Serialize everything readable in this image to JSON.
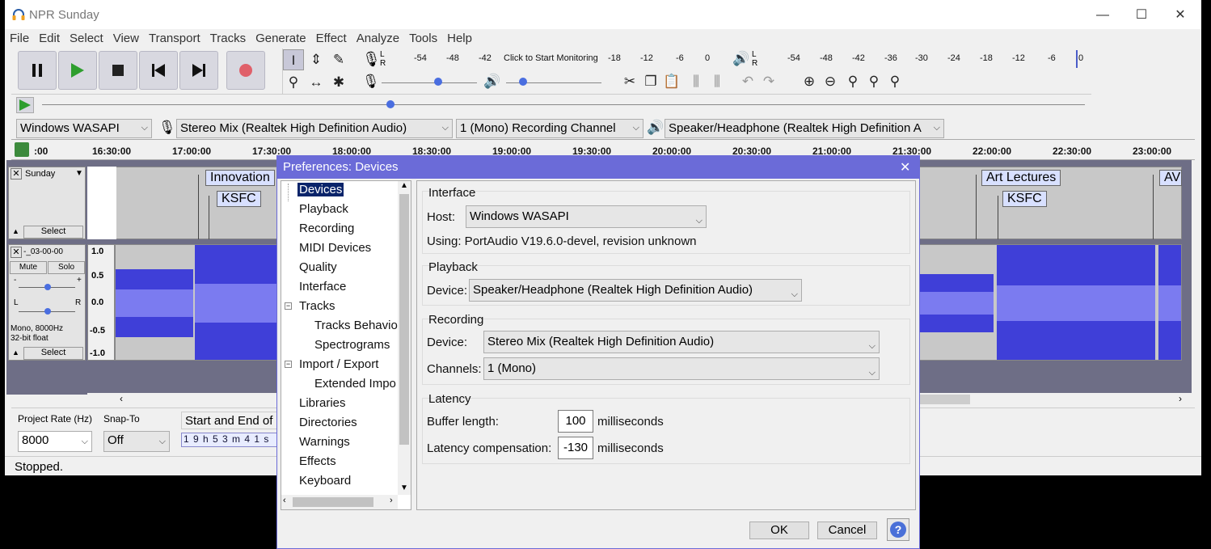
{
  "window": {
    "title": "NPR Sunday",
    "min": "—",
    "max": "☐",
    "close": "✕"
  },
  "menu": [
    "File",
    "Edit",
    "Select",
    "View",
    "Transport",
    "Tracks",
    "Generate",
    "Effect",
    "Analyze",
    "Tools",
    "Help"
  ],
  "meters": {
    "record_channels": "L\nR",
    "play_channels": "L\nR",
    "record_scale": [
      "-54",
      "-48",
      "-42",
      "-18",
      "-12",
      "-6",
      "0"
    ],
    "monitor_text": "Click to Start Monitoring",
    "play_scale": [
      "-54",
      "-48",
      "-42",
      "-36",
      "-30",
      "-24",
      "-18",
      "-12",
      "-6",
      "0"
    ]
  },
  "device_toolbar": {
    "host": "Windows WASAPI",
    "recording_device": "Stereo Mix (Realtek High Definition Audio)",
    "channels": "1 (Mono) Recording Channel",
    "playback_device": "Speaker/Headphone (Realtek High Definition A"
  },
  "ruler": {
    "labels": [
      ":00",
      "16:30:00",
      "17:00:00",
      "17:30:00",
      "18:00:00",
      "18:30:00",
      "19:00:00",
      "19:30:00",
      "20:00:00",
      "20:30:00",
      "21:00:00",
      "21:30:00",
      "22:00:00",
      "22:30:00",
      "23:00:00"
    ]
  },
  "label_track": {
    "name": "Sunday",
    "select": "Select",
    "labels": [
      "Innovation",
      "KSFC",
      "Art Lectures",
      "KSFC",
      "AV"
    ]
  },
  "audio_track": {
    "name": "-_03-00-00",
    "mute": "Mute",
    "solo": "Solo",
    "gain_minus": "-",
    "gain_plus": "+",
    "pan_left": "L",
    "pan_right": "R",
    "info_line1": "Mono, 8000Hz",
    "info_line2": "32-bit float",
    "select": "Select",
    "scale": [
      "1.0",
      "0.5",
      "0.0",
      "-0.5",
      "-1.0"
    ]
  },
  "selection_toolbar": {
    "project_rate_label": "Project Rate (Hz)",
    "project_rate": "8000",
    "snap_label": "Snap-To",
    "snap": "Off",
    "start_end_label": "Start and End of",
    "time": "1 9 h 5 3 m 4 1 s"
  },
  "status": "Stopped.",
  "dialog": {
    "title": "Preferences: Devices",
    "close": "✕",
    "tree": [
      "Devices",
      "Playback",
      "Recording",
      "MIDI Devices",
      "Quality",
      "Interface",
      "Tracks",
      "Tracks Behavio",
      "Spectrograms",
      "Import / Export",
      "Extended Impo",
      "Libraries",
      "Directories",
      "Warnings",
      "Effects",
      "Keyboard"
    ],
    "interface": {
      "title": "Interface",
      "host_label": "Host:",
      "host": "Windows WASAPI",
      "using": "Using: PortAudio V19.6.0-devel, revision unknown"
    },
    "playback": {
      "title": "Playback",
      "device_label": "Device:",
      "device": "Speaker/Headphone (Realtek High Definition Audio)"
    },
    "recording": {
      "title": "Recording",
      "device_label": "Device:",
      "device": "Stereo Mix (Realtek High Definition Audio)",
      "channels_label": "Channels:",
      "channels": "1 (Mono)"
    },
    "latency": {
      "title": "Latency",
      "buffer_label": "Buffer length:",
      "buffer": "100",
      "buffer_unit": "milliseconds",
      "comp_label": "Latency compensation:",
      "comp": "-130",
      "comp_unit": "milliseconds"
    },
    "ok": "OK",
    "cancel": "Cancel",
    "help": "?"
  },
  "colors": {
    "accent": "#6b6bd8",
    "waveform": "#3f3fd8",
    "waveform_rms": "#7b7bf0",
    "selected_tree": "#0a246a"
  }
}
